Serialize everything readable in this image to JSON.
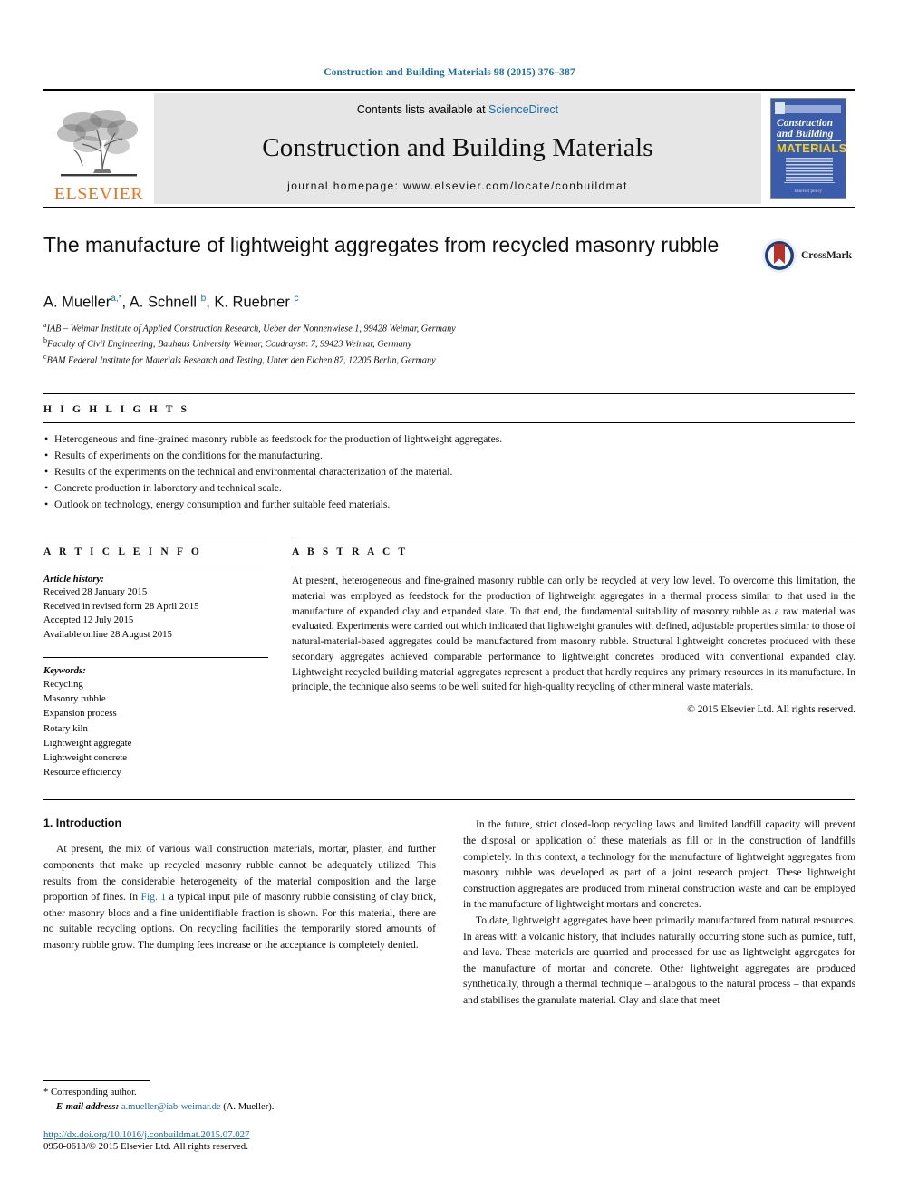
{
  "running_head": "Construction and Building Materials 98 (2015) 376–387",
  "masthead": {
    "publisher_name": "ELSEVIER",
    "contents_prefix": "Contents lists available at ",
    "contents_link": "ScienceDirect",
    "journal_title": "Construction and Building Materials",
    "homepage": "journal homepage: www.elsevier.com/locate/conbuildmat",
    "cover": {
      "line1": "Construction",
      "line2": "and Building",
      "line3": "MATERIALS",
      "footnote": "Elsevier policy"
    }
  },
  "article": {
    "title": "The manufacture of lightweight aggregates from recycled masonry rubble",
    "crossmark_label": "CrossMark",
    "authors_html": "A. Mueller<sup>a,*</sup>, A. Schnell <sup>b</sup>, K. Ruebner <sup>c</sup>",
    "affiliations": [
      {
        "marker": "a",
        "text": "IAB – Weimar Institute of Applied Construction Research, Ueber der Nonnenwiese 1, 99428 Weimar, Germany"
      },
      {
        "marker": "b",
        "text": "Faculty of Civil Engineering, Bauhaus University Weimar, Coudraystr. 7, 99423 Weimar, Germany"
      },
      {
        "marker": "c",
        "text": "BAM Federal Institute for Materials Research and Testing, Unter den Eichen 87, 12205 Berlin, Germany"
      }
    ]
  },
  "highlights": {
    "heading": "H I G H L I G H T S",
    "items": [
      "Heterogeneous and fine-grained masonry rubble as feedstock for the production of lightweight aggregates.",
      "Results of experiments on the conditions for the manufacturing.",
      "Results of the experiments on the technical and environmental characterization of the material.",
      "Concrete production in laboratory and technical scale.",
      "Outlook on technology, energy consumption and further suitable feed materials."
    ]
  },
  "article_info": {
    "heading": "A R T I C L E   I N F O",
    "history_label": "Article history:",
    "history": [
      "Received 28 January 2015",
      "Received in revised form 28 April 2015",
      "Accepted 12 July 2015",
      "Available online 28 August 2015"
    ],
    "keywords_label": "Keywords:",
    "keywords": [
      "Recycling",
      "Masonry rubble",
      "Expansion process",
      "Rotary kiln",
      "Lightweight aggregate",
      "Lightweight concrete",
      "Resource efficiency"
    ]
  },
  "abstract": {
    "heading": "A B S T R A C T",
    "text": "At present, heterogeneous and fine-grained masonry rubble can only be recycled at very low level. To overcome this limitation, the material was employed as feedstock for the production of lightweight aggregates in a thermal process similar to that used in the manufacture of expanded clay and expanded slate. To that end, the fundamental suitability of masonry rubble as a raw material was evaluated. Experiments were carried out which indicated that lightweight granules with defined, adjustable properties similar to those of natural-material-based aggregates could be manufactured from masonry rubble. Structural lightweight concretes produced with these secondary aggregates achieved comparable performance to lightweight concretes produced with conventional expanded clay. Lightweight recycled building material aggregates represent a product that hardly requires any primary resources in its manufacture. In principle, the technique also seems to be well suited for high-quality recycling of other mineral waste materials.",
    "copyright": "© 2015 Elsevier Ltd. All rights reserved."
  },
  "body": {
    "section_heading": "1. Introduction",
    "left_para_1_a": "At present, the mix of various wall construction materials, mortar, plaster, and further components that make up recycled masonry rubble cannot be adequately utilized. This results from the considerable heterogeneity of the material composition and the large proportion of fines. In ",
    "left_para_1_link": "Fig. 1",
    "left_para_1_b": " a typical input pile of masonry rubble consisting of clay brick, other masonry blocs and a fine unidentifiable fraction is shown. For this material, there are no suitable recycling options. On recycling facilities the temporarily stored amounts of masonry rubble grow. The dumping fees increase or the acceptance is completely denied.",
    "right_para_1": "In the future, strict closed-loop recycling laws and limited landfill capacity will prevent the disposal or application of these materials as fill or in the construction of landfills completely. In this context, a technology for the manufacture of lightweight aggregates from masonry rubble was developed as part of a joint research project. These lightweight construction aggregates are produced from mineral construction waste and can be employed in the manufacture of lightweight mortars and concretes.",
    "right_para_2": "To date, lightweight aggregates have been primarily manufactured from natural resources. In areas with a volcanic history, that includes naturally occurring stone such as pumice, tuff, and lava. These materials are quarried and processed for use as lightweight aggregates for the manufacture of mortar and concrete. Other lightweight aggregates are produced synthetically, through a thermal technique – analogous to the natural process – that expands and stabilises the granulate material. Clay and slate that meet"
  },
  "footer": {
    "corresponding_marker": "*",
    "corresponding_label": "Corresponding author.",
    "email_label": "E-mail address:",
    "email": "a.mueller@iab-weimar.de",
    "email_suffix": "(A. Mueller).",
    "doi": "http://dx.doi.org/10.1016/j.conbuildmat.2015.07.027",
    "issn": "0950-0618/© 2015 Elsevier Ltd. All rights reserved."
  },
  "colors": {
    "link_blue": "#1a6ca8",
    "elsevier_orange": "#E87722",
    "cover_blue": "#3b5bab",
    "cover_yellow": "#f2d024",
    "crossmark_red": "#b5312a"
  }
}
